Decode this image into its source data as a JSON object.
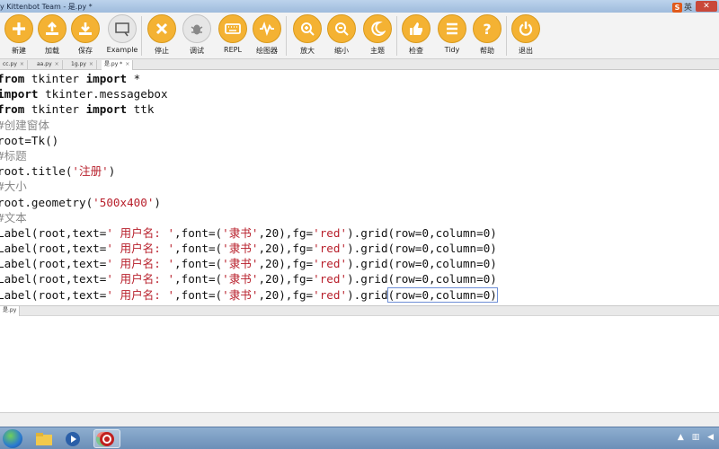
{
  "window": {
    "title": "y Kittenbot Team - 是.py *",
    "ime_logo": "S",
    "ime_label": "英",
    "close_label": "✕"
  },
  "toolbar": {
    "buttons": [
      {
        "label": "新建",
        "icon": "plus-icon"
      },
      {
        "label": "加载",
        "icon": "upload-icon"
      },
      {
        "label": "保存",
        "icon": "download-icon"
      },
      {
        "label": "Example",
        "icon": "example-icon"
      },
      {
        "label": "停止",
        "icon": "stop-icon"
      },
      {
        "label": "调试",
        "icon": "bug-icon"
      },
      {
        "label": "REPL",
        "icon": "keyboard-icon"
      },
      {
        "label": "绘图器",
        "icon": "wave-icon"
      },
      {
        "label": "放大",
        "icon": "zoom-in-icon"
      },
      {
        "label": "缩小",
        "icon": "zoom-out-icon"
      },
      {
        "label": "主题",
        "icon": "moon-icon"
      },
      {
        "label": "检查",
        "icon": "thumbs-up-icon"
      },
      {
        "label": "Tidy",
        "icon": "list-icon"
      },
      {
        "label": "帮助",
        "icon": "help-icon"
      },
      {
        "label": "退出",
        "icon": "power-icon"
      }
    ]
  },
  "tabs": [
    {
      "label": "cc.py",
      "close": "×"
    },
    {
      "label": "aa.py",
      "close": "×"
    },
    {
      "label": "1g.py",
      "close": "×"
    },
    {
      "label": "是.py *",
      "close": "×"
    }
  ],
  "editor": {
    "lines": [
      {
        "parts": [
          {
            "t": "from",
            "c": "kw"
          },
          {
            "t": " tkinter ",
            "c": ""
          },
          {
            "t": "import",
            "c": "kw"
          },
          {
            "t": " *",
            "c": ""
          }
        ]
      },
      {
        "parts": [
          {
            "t": "import",
            "c": "kw"
          },
          {
            "t": " tkinter.messagebox",
            "c": ""
          }
        ]
      },
      {
        "parts": [
          {
            "t": "from",
            "c": "kw"
          },
          {
            "t": " tkinter ",
            "c": ""
          },
          {
            "t": "import",
            "c": "kw"
          },
          {
            "t": " ttk",
            "c": ""
          }
        ]
      },
      {
        "parts": [
          {
            "t": "#创建窗体",
            "c": "cm"
          }
        ]
      },
      {
        "parts": [
          {
            "t": "root=Tk()",
            "c": ""
          }
        ]
      },
      {
        "parts": [
          {
            "t": "#标题",
            "c": "cm"
          }
        ]
      },
      {
        "parts": [
          {
            "t": "root.title(",
            "c": ""
          },
          {
            "t": "'注册'",
            "c": "str"
          },
          {
            "t": ")",
            "c": ""
          }
        ]
      },
      {
        "parts": [
          {
            "t": "#大小",
            "c": "cm"
          }
        ]
      },
      {
        "parts": [
          {
            "t": "root.geometry(",
            "c": ""
          },
          {
            "t": "'500x400'",
            "c": "str"
          },
          {
            "t": ")",
            "c": ""
          }
        ]
      },
      {
        "parts": [
          {
            "t": "#文本",
            "c": "cm"
          }
        ]
      },
      {
        "parts": [
          {
            "t": "Label(root,text=",
            "c": ""
          },
          {
            "t": "' 用户名: '",
            "c": "str"
          },
          {
            "t": ",font=(",
            "c": ""
          },
          {
            "t": "'隶书'",
            "c": "str"
          },
          {
            "t": ",20),fg=",
            "c": ""
          },
          {
            "t": "'red'",
            "c": "str"
          },
          {
            "t": ").grid(row=0,column=0)",
            "c": ""
          }
        ]
      },
      {
        "parts": [
          {
            "t": "Label(root,text=",
            "c": ""
          },
          {
            "t": "' 用户名: '",
            "c": "str"
          },
          {
            "t": ",font=(",
            "c": ""
          },
          {
            "t": "'隶书'",
            "c": "str"
          },
          {
            "t": ",20),fg=",
            "c": ""
          },
          {
            "t": "'red'",
            "c": "str"
          },
          {
            "t": ").grid(row=0,column=0)",
            "c": ""
          }
        ]
      },
      {
        "parts": [
          {
            "t": "Label(root,text=",
            "c": ""
          },
          {
            "t": "' 用户名: '",
            "c": "str"
          },
          {
            "t": ",font=(",
            "c": ""
          },
          {
            "t": "'隶书'",
            "c": "str"
          },
          {
            "t": ",20),fg=",
            "c": ""
          },
          {
            "t": "'red'",
            "c": "str"
          },
          {
            "t": ").grid(row=0,column=0)",
            "c": ""
          }
        ]
      },
      {
        "parts": [
          {
            "t": "Label(root,text=",
            "c": ""
          },
          {
            "t": "' 用户名: '",
            "c": "str"
          },
          {
            "t": ",font=(",
            "c": ""
          },
          {
            "t": "'隶书'",
            "c": "str"
          },
          {
            "t": ",20),fg=",
            "c": ""
          },
          {
            "t": "'red'",
            "c": "str"
          },
          {
            "t": ").grid(row=0,column=0)",
            "c": ""
          }
        ]
      },
      {
        "parts": [
          {
            "t": "Label(root,text=",
            "c": ""
          },
          {
            "t": "' 用户名: '",
            "c": "str"
          },
          {
            "t": ",font=(",
            "c": ""
          },
          {
            "t": "'隶书'",
            "c": "str"
          },
          {
            "t": ",20),fg=",
            "c": ""
          },
          {
            "t": "'red'",
            "c": "str"
          },
          {
            "t": ").grid",
            "c": ""
          },
          {
            "t": "(row=0,column=0)",
            "c": "paren-hl"
          }
        ]
      }
    ]
  },
  "shell_tab": {
    "label": "是.py"
  },
  "colors": {
    "accent": "#f4b233",
    "string": "#b8202c",
    "comment": "#8a8a8a"
  }
}
